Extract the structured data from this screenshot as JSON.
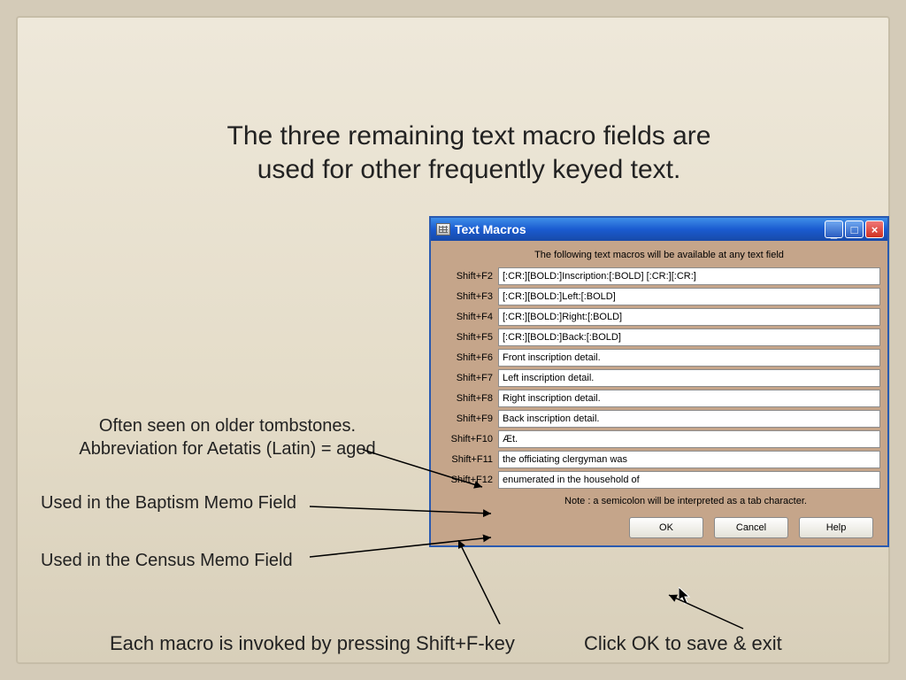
{
  "heading": {
    "line1": "The three remaining text macro fields are",
    "line2": "used for other frequently keyed text."
  },
  "notes": {
    "aetatis_line1": "Often seen on older tombstones.",
    "aetatis_line2": "Abbreviation for Aetatis (Latin) = aged",
    "baptism": "Used in the Baptism Memo Field",
    "census": "Used in the Census Memo Field"
  },
  "footer": {
    "invoke": "Each macro is invoked by pressing Shift+F-key",
    "ok": "Click OK to save & exit"
  },
  "dialog": {
    "title": "Text Macros",
    "intro": "The following text macros will be available at any text field",
    "rows": [
      {
        "key": "Shift+F2",
        "val": "[:CR:][BOLD:]Inscription:[:BOLD] [:CR:][:CR:]"
      },
      {
        "key": "Shift+F3",
        "val": "[:CR:][BOLD:]Left:[:BOLD]"
      },
      {
        "key": "Shift+F4",
        "val": "[:CR:][BOLD:]Right:[:BOLD]"
      },
      {
        "key": "Shift+F5",
        "val": "[:CR:][BOLD:]Back:[:BOLD]"
      },
      {
        "key": "Shift+F6",
        "val": "Front inscription detail."
      },
      {
        "key": "Shift+F7",
        "val": "Left inscription detail."
      },
      {
        "key": "Shift+F8",
        "val": "Right inscription detail."
      },
      {
        "key": "Shift+F9",
        "val": "Back inscription detail."
      },
      {
        "key": "Shift+F10",
        "val": "Æt."
      },
      {
        "key": "Shift+F11",
        "val": "the officiating clergyman was"
      },
      {
        "key": "Shift+F12",
        "val": "enumerated in the household of "
      }
    ],
    "note": "Note :  a semicolon will be interpreted as a tab character.",
    "buttons": {
      "ok": "OK",
      "cancel": "Cancel",
      "help": "Help"
    }
  }
}
